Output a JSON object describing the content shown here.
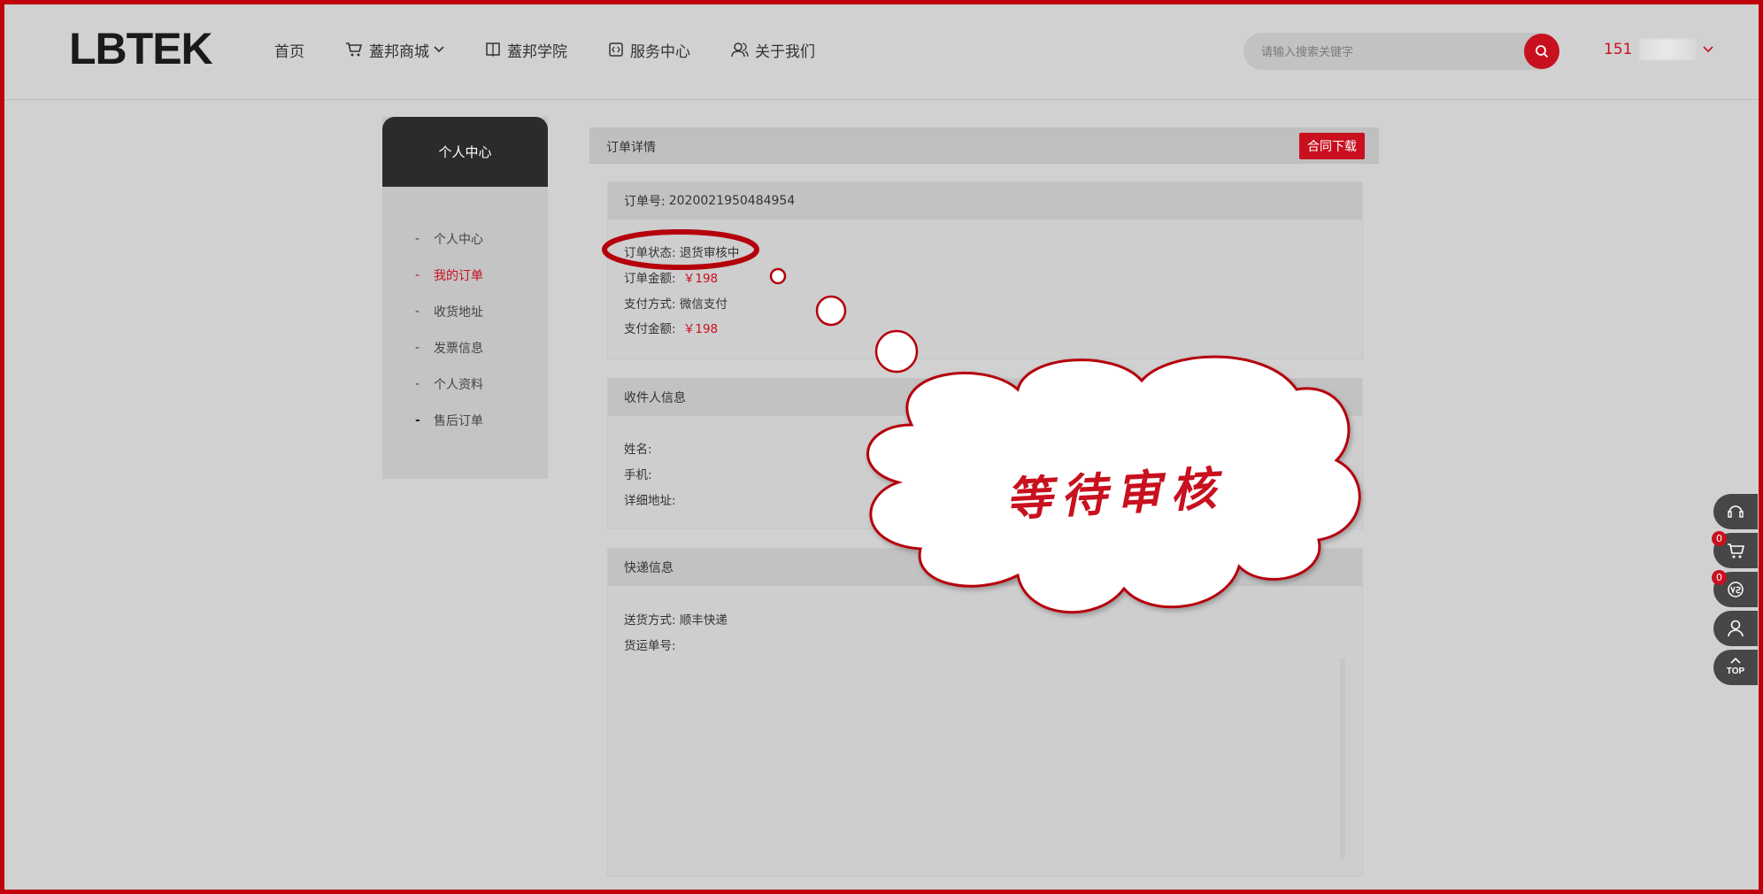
{
  "header": {
    "logo_text": "LBTEK",
    "nav": [
      {
        "label": "首页"
      },
      {
        "label": "蓋邦商城"
      },
      {
        "label": "蓋邦学院"
      },
      {
        "label": "服务中心"
      },
      {
        "label": "关于我们"
      }
    ],
    "search": {
      "placeholder": "请输入搜索关键字"
    },
    "user": {
      "label": "151"
    }
  },
  "sidebar": {
    "title": "个人中心",
    "items": [
      {
        "dash": "-",
        "label": "个人中心"
      },
      {
        "dash": "-",
        "label": "我的订单"
      },
      {
        "dash": "-",
        "label": "收货地址"
      },
      {
        "dash": "-",
        "label": "发票信息"
      },
      {
        "dash": "-",
        "label": "个人资料"
      },
      {
        "dash": "-",
        "label": "售后订单"
      }
    ]
  },
  "main": {
    "title": "订单详情",
    "contract_button": "合同下载",
    "order": {
      "number_label": "订单号:",
      "number": "2020021950484954",
      "status_label": "订单状态:",
      "status": "退货审核中",
      "amount_label": "订单金额:",
      "amount": "￥198",
      "pay_method_label": "支付方式:",
      "pay_method": "微信支付",
      "paid_label": "支付金额:",
      "paid": "￥198"
    },
    "receiver": {
      "title": "收件人信息",
      "name_label": "姓名:",
      "phone_label": "手机:",
      "address_label": "详细地址:"
    },
    "shipping": {
      "title": "快递信息",
      "method_label": "送货方式:",
      "method": "顺丰快递",
      "tracking_label": "货运单号:"
    }
  },
  "tools": {
    "cart_count": "0",
    "compare_count": "0",
    "top_label": "TOP"
  },
  "annotation": {
    "cloud_text": "等待审核"
  },
  "colors": {
    "accent": "#c8101e",
    "sidebar_header": "#2b2b2b",
    "background": "#d1d1d1"
  }
}
